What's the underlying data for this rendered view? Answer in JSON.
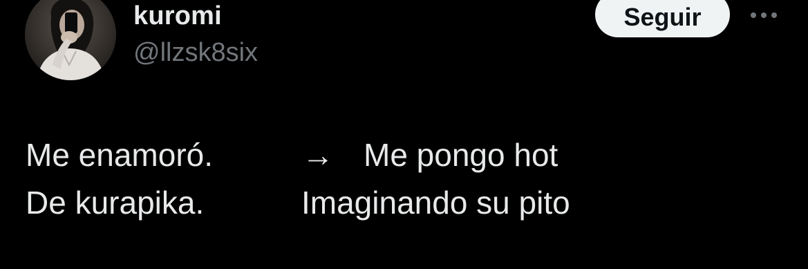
{
  "user": {
    "display_name": "kuromi",
    "handle": "@llzsk8six",
    "avatar_icon": "profile-photo"
  },
  "actions": {
    "follow_label": "Seguir",
    "more_icon": "ellipsis-icon"
  },
  "tweet": {
    "left_line_1": "Me enamoró.",
    "left_line_2": "De kurapika.",
    "arrow": "→",
    "right_line_1": "Me pongo hot",
    "right_line_2": "Imaginando su pito"
  },
  "colors": {
    "background": "#000000",
    "text": "#e7e9ea",
    "secondary_text": "#71767b",
    "button_bg": "#eff3f4",
    "button_text": "#0f1419"
  }
}
